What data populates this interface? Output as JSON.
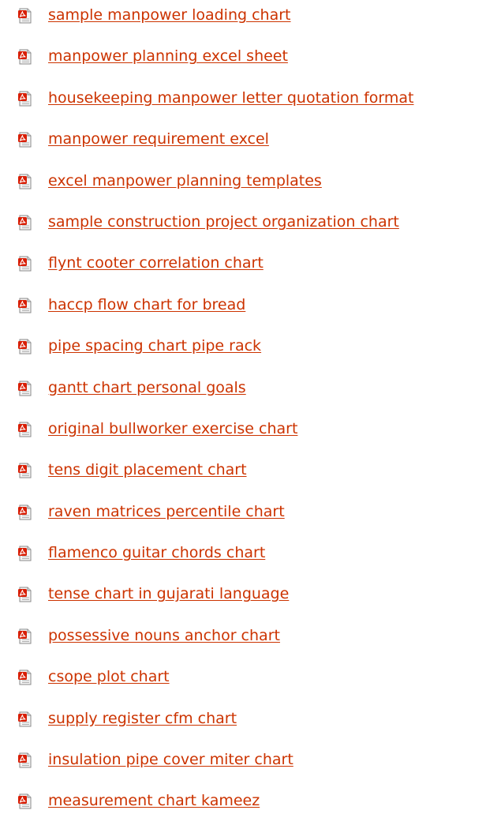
{
  "link_color": "#cc3300",
  "icon": "pdf-file-icon",
  "links": [
    {
      "label": "sample manpower loading chart"
    },
    {
      "label": "manpower planning excel sheet"
    },
    {
      "label": "housekeeping manpower letter quotation format"
    },
    {
      "label": "manpower requirement excel"
    },
    {
      "label": "excel manpower planning templates"
    },
    {
      "label": "sample construction project organization chart"
    },
    {
      "label": "flynt cooter correlation chart"
    },
    {
      "label": "haccp flow chart for bread"
    },
    {
      "label": "pipe spacing chart pipe rack"
    },
    {
      "label": "gantt chart personal goals"
    },
    {
      "label": "original bullworker exercise chart"
    },
    {
      "label": "tens digit placement chart"
    },
    {
      "label": "raven matrices percentile chart"
    },
    {
      "label": "flamenco guitar chords chart"
    },
    {
      "label": "tense chart in gujarati language"
    },
    {
      "label": "possessive nouns anchor chart"
    },
    {
      "label": "csope plot chart"
    },
    {
      "label": "supply register cfm chart"
    },
    {
      "label": "insulation pipe cover miter chart"
    },
    {
      "label": "measurement chart kameez"
    }
  ]
}
